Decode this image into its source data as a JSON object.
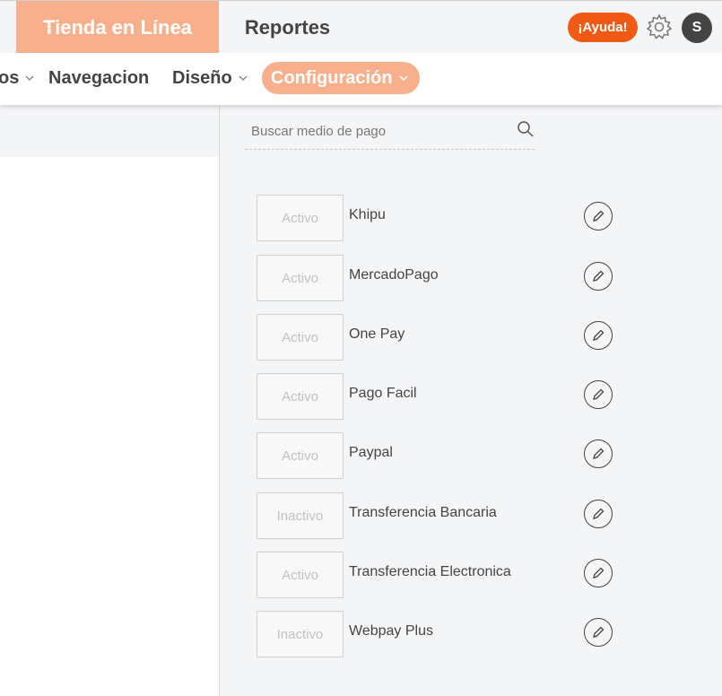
{
  "header": {
    "tabs": [
      {
        "label": "Tienda en Línea",
        "active": true
      },
      {
        "label": "Reportes",
        "active": false
      }
    ],
    "help_label": "¡Ayuda!",
    "avatar_initial": "S",
    "colors": {
      "accent": "#f8b08c",
      "help": "#f05a14"
    }
  },
  "nav": {
    "items": [
      {
        "label": "os",
        "dropdown": true
      },
      {
        "label": "Navegacion",
        "dropdown": false
      },
      {
        "label": "Diseño",
        "dropdown": true
      },
      {
        "label": "Configuración",
        "dropdown": true,
        "active": true
      }
    ]
  },
  "search": {
    "placeholder": "Buscar medio de pago"
  },
  "payment_methods": [
    {
      "status": "Activo",
      "name": "Khipu"
    },
    {
      "status": "Activo",
      "name": "MercadoPago"
    },
    {
      "status": "Activo",
      "name": "One Pay"
    },
    {
      "status": "Activo",
      "name": "Pago Facil"
    },
    {
      "status": "Activo",
      "name": "Paypal"
    },
    {
      "status": "Inactivo",
      "name": "Transferencia Bancaria"
    },
    {
      "status": "Activo",
      "name": "Transferencia Electronica"
    },
    {
      "status": "Inactivo",
      "name": "Webpay Plus"
    }
  ]
}
